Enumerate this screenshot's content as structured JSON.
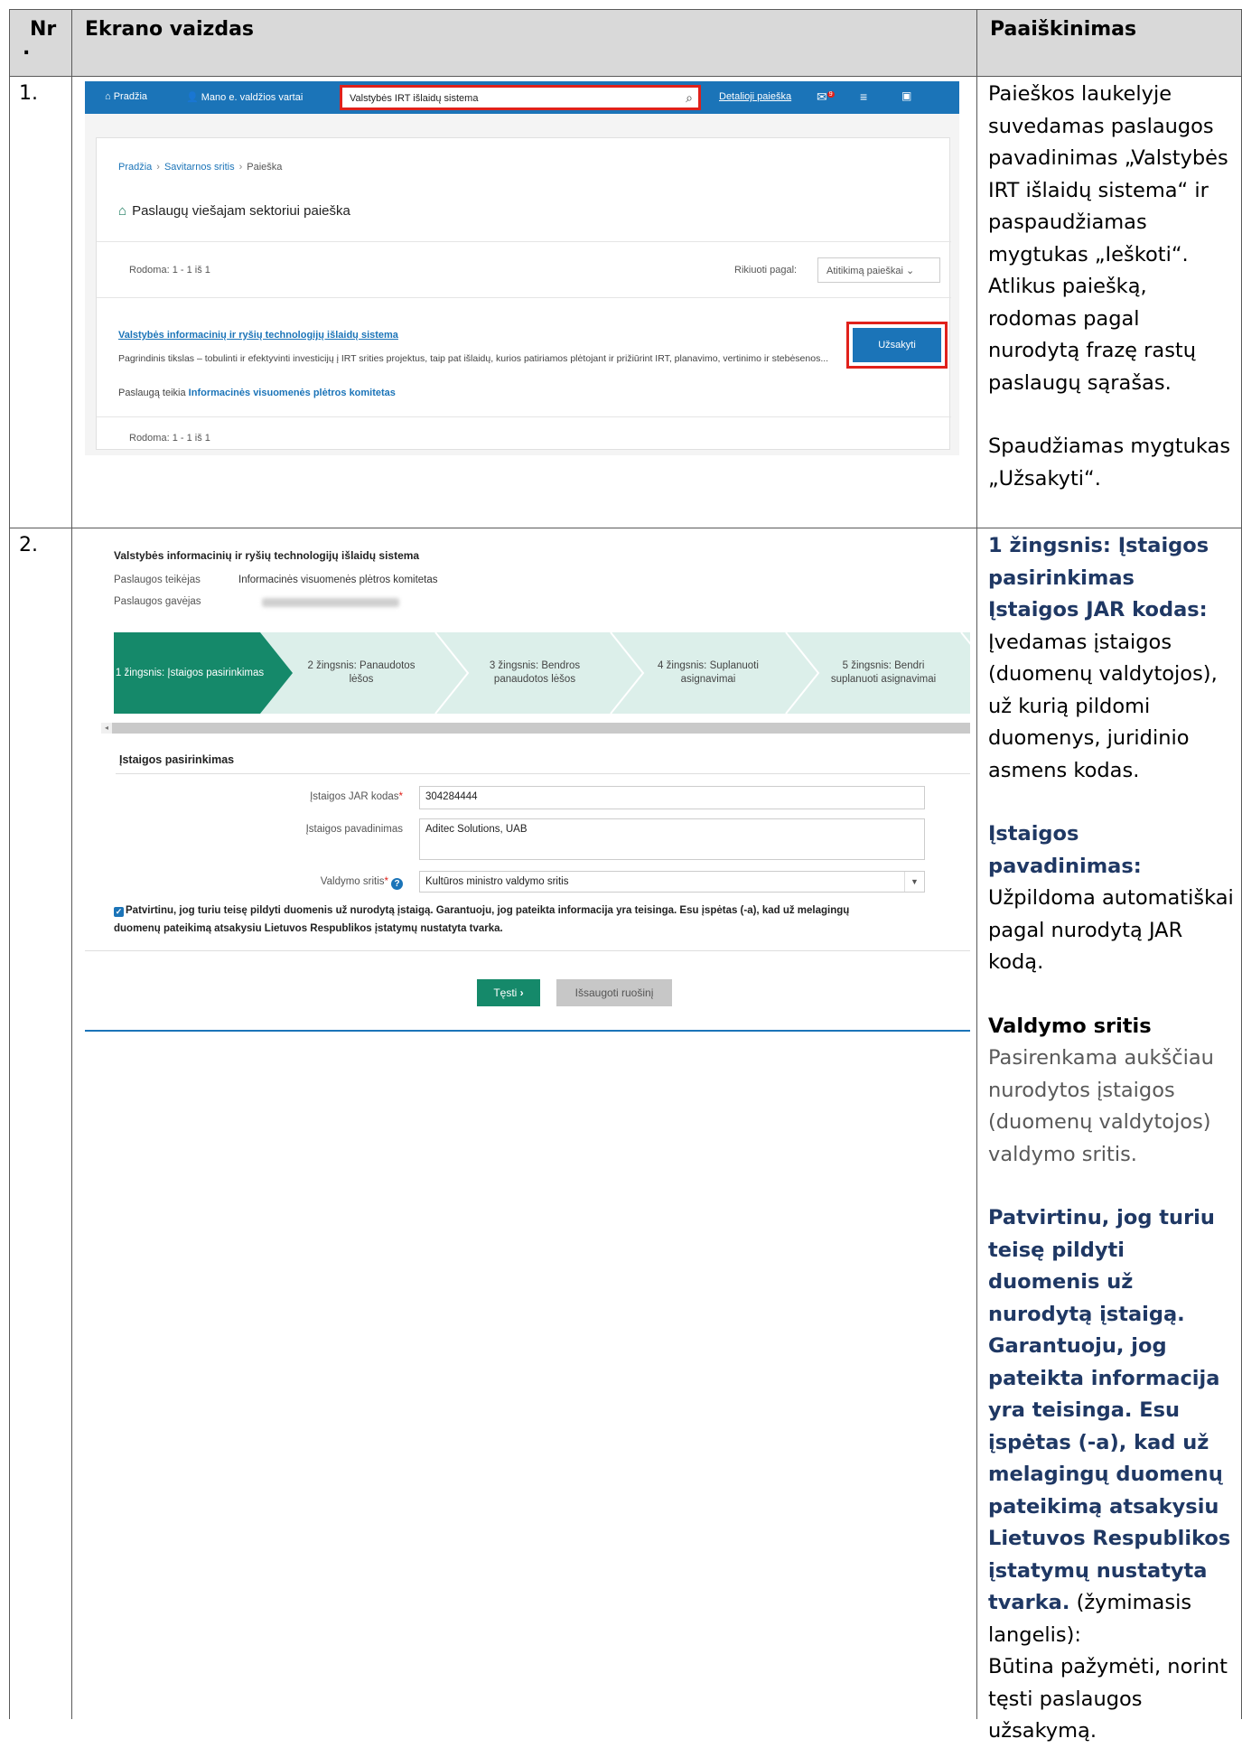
{
  "header": {
    "col_nr": "Nr",
    "col_nr_dot": ".",
    "col_screen": "Ekrano vaizdas",
    "col_expl": "Paaiškinimas"
  },
  "row1": {
    "nr": "1.",
    "explanation": {
      "p1": "Paieškos laukelyje suvedamas paslaugos pavadinimas „Valstybės IRT išlaidų sistema“ ir paspaudžiamas mygtukas „Ieškoti“. Atlikus paiešką, rodomas pagal nurodytą frazę rastų paslaugų sąrašas.",
      "p2": "Spaudžiamas mygtukas „Užsakyti“."
    },
    "screen": {
      "nav_home": "Pradžia",
      "nav_portal": "Mano e. valdžios vartai",
      "search_value": "Valstybės IRT išlaidų sistema",
      "detailed_search": "Detalioji paieška",
      "mail_badge": "9",
      "breadcrumb": [
        "Pradžia",
        "Savitarnos sritis",
        "Paieška"
      ],
      "page_title": "Paslaugų viešajam sektoriui paieška",
      "results_count": "Rodoma: 1 - 1 iš 1",
      "sort_label": "Rikiuoti pagal:",
      "sort_value": "Atitikimą paieškai",
      "service_title": "Valstybės informacinių ir ryšių technologijų išlaidų sistema",
      "service_desc": "Pagrindinis tikslas – tobulinti ir efektyvinti investicijų į IRT srities projektus, taip pat išlaidų, kurios patiriamos plėtojant ir prižiūrint IRT, planavimo, vertinimo ir stebėsenos...",
      "provider_prefix": "Paslaugą teikia",
      "provider_name": "Informacinės visuomenės plėtros komitetas",
      "order_button": "Užsakyti"
    }
  },
  "row2": {
    "nr": "2.",
    "explanation": {
      "step_title": "1 žingsnis: Įstaigos pasirinkimas",
      "jar_title": "Įstaigos JAR kodas:",
      "jar_text": "Įvedamas įstaigos (duomenų valdytojos), už kurią pildomi duomenys, juridinio asmens kodas.",
      "name_title": "Įstaigos pavadinimas:",
      "name_text": "Užpildoma automatiškai pagal nurodytą JAR kodą.",
      "area_title": "Valdymo sritis",
      "area_text_dim": "Pasirenkama aukščiau nurodytos įstaigos (duomenų valdytojos)",
      "area_text": "valdymo sritis.",
      "confirm_title": "Patvirtinu, jog turiu teisę pildyti duomenis už nurodytą įstaigą. Garantuoju, jog pateikta informacija yra teisinga. Esu įspėtas (-a), kad už melagingų duomenų pateikimą atsakysiu Lietuvos Respublikos įstatymų nustatyta tvarka.",
      "confirm_suffix": "(žymimasis langelis):",
      "confirm_text": "Būtina pažymėti, norint tęsti paslaugos užsakymą."
    },
    "screen": {
      "service_title": "Valstybės informacinių ir ryšių technologijų išlaidų sistema",
      "provider_label": "Paslaugos teikėjas",
      "provider_value": "Informacinės visuomenės plėtros komitetas",
      "receiver_label": "Paslaugos gavėjas",
      "steps": [
        "1 žingsnis: Įstaigos pasirinkimas",
        "2 žingsnis: Panaudotos lėšos",
        "3 žingsnis: Bendros panaudotos lėšos",
        "4 žingsnis: Suplanuoti asignavimai",
        "5 žingsnis: Bendri suplanuoti asignavimai"
      ],
      "section_title": "Įstaigos pasirinkimas",
      "jar_label": "Įstaigos JAR kodas",
      "jar_value": "304284444",
      "name_label": "Įstaigos pavadinimas",
      "name_value": "Aditec Solutions, UAB",
      "area_label": "Valdymo sritis",
      "area_value": "Kultūros ministro valdymo sritis",
      "confirm_line1": "Patvirtinu, jog turiu teisę pildyti duomenis už nurodytą įstaigą. Garantuoju, jog pateikta informacija yra teisinga. Esu įspėtas (-a), kad už melagingų",
      "confirm_line2": "duomenų pateikimą atsakysiu Lietuvos Respublikos įstatymų nustatyta tvarka.",
      "continue_button": "Tęsti",
      "save_draft_button": "Išsaugoti ruošinį"
    }
  },
  "colors": {
    "accent_blue": "#1b74b8",
    "step_active": "#15896a",
    "highlight_red": "#e0211b",
    "explanation_blue": "#1f3864"
  }
}
